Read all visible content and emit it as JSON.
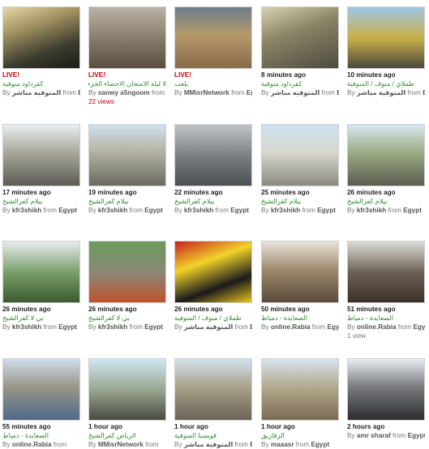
{
  "cards": [
    {
      "status": "LIVE!",
      "live": true,
      "title": "كفرداود منوفية",
      "by": "By",
      "user": "المنوفية مباشر",
      "from": "from",
      "place": "Egypt",
      "views": "",
      "views_red": false,
      "scene": "linear-gradient(160deg,#e8d9a8 0%,#9a8c5c 35%,#3a3a2e 70%,#1c1c18 100%)"
    },
    {
      "status": "LIVE!",
      "live": true,
      "title": "لا ليلة الامتحان الاحصاء الجزء الاول",
      "by": "By",
      "user": "sanwy a5ngoom",
      "from": "from",
      "place": "Egypt",
      "views": "22 views",
      "views_red": true,
      "scene": "linear-gradient(180deg,#b9b2a6 0%,#8a7d6d 50%,#5a4d40 100%)"
    },
    {
      "status": "LIVE!",
      "live": true,
      "title": "يلعب",
      "by": "By",
      "user": "MMisrNetwork",
      "from": "from",
      "place": "Egypt",
      "views": "",
      "views_red": false,
      "scene": "linear-gradient(180deg,#6c7c8c 0%,#b49a6a 45%,#8a6a4a 100%)"
    },
    {
      "status": "8 minutes ago",
      "live": false,
      "title": "كفرداود منوفية",
      "by": "By",
      "user": "المنوفية مباشر",
      "from": "from",
      "place": "Egypt",
      "views": "",
      "views_red": false,
      "scene": "linear-gradient(160deg,#d9d2b2 0%,#8c8668 40%,#4c4a3c 100%)"
    },
    {
      "status": "10 minutes ago",
      "live": false,
      "title": "طملاي / منوف / المنوفية",
      "by": "By",
      "user": "المنوفية مباشر",
      "from": "from",
      "place": "Egypt",
      "views": "",
      "views_red": false,
      "scene": "linear-gradient(180deg,#9fc6e6 0%,#c9b04a 50%,#4a4a3c 100%)"
    },
    {
      "status": "17 minutes ago",
      "live": false,
      "title": "بيلام كفرالشيخ",
      "by": "By",
      "user": "kfr3shikh",
      "from": "from",
      "place": "Egypt",
      "views": "",
      "views_red": false,
      "scene": "linear-gradient(180deg,#eaeef0 0%,#a8a89a 45%,#5c5c54 100%)"
    },
    {
      "status": "19 minutes ago",
      "live": false,
      "title": "بيلام كفرالشيخ",
      "by": "By",
      "user": "kfr3shikh",
      "from": "from",
      "place": "Egypt",
      "views": "",
      "views_red": false,
      "scene": "linear-gradient(180deg,#cfe0ec 0%,#b8b8aa 40%,#6a6a60 100%)"
    },
    {
      "status": "22 minutes ago",
      "live": false,
      "title": "بيلام كفرالشيخ",
      "by": "By",
      "user": "kfr3shikh",
      "from": "from",
      "place": "Egypt",
      "views": "",
      "views_red": false,
      "scene": "linear-gradient(180deg,#bfc4c8 0%,#7c8084 50%,#4c5054 100%)"
    },
    {
      "status": "25 minutes ago",
      "live": false,
      "title": "بيلام كفرالشيخ",
      "by": "By",
      "user": "kfr3shikh",
      "from": "from",
      "place": "Egypt",
      "views": "",
      "views_red": false,
      "scene": "linear-gradient(180deg,#cfe2f0 0%,#d8d8d0 45%,#8a8a80 100%)"
    },
    {
      "status": "26 minutes ago",
      "live": false,
      "title": "بيلام كفرالشيخ",
      "by": "By",
      "user": "kfr3shikh",
      "from": "from",
      "place": "Egypt",
      "views": "",
      "views_red": false,
      "scene": "linear-gradient(180deg,#d6e6f0 0%,#9cae86 45%,#5c5c50 100%)"
    },
    {
      "status": "26 minutes ago",
      "live": false,
      "title": "بي لا كفرالشيخ",
      "by": "By",
      "user": "kfr3shikh",
      "from": "from",
      "place": "Egypt",
      "views": "",
      "views_red": false,
      "scene": "linear-gradient(180deg,#e8ecef 0%,#7aa06a 50%,#3c5a30 100%)"
    },
    {
      "status": "26 minutes ago",
      "live": false,
      "title": "بي لا كفرالشيخ",
      "by": "By",
      "user": "kfr3shikh",
      "from": "from",
      "place": "Egypt",
      "views": "",
      "views_red": false,
      "scene": "linear-gradient(180deg,#6a9c5a 0%,#8a8878 50%,#c0522c 100%)"
    },
    {
      "status": "26 minutes ago",
      "live": false,
      "title": "طملاي / منوف / المنوفية",
      "by": "By",
      "user": "المنوفية مباشر",
      "from": "from",
      "place": "Egypt",
      "views": "",
      "views_red": false,
      "scene": "linear-gradient(160deg,#c8201e 0%,#f2d22a 35%,#1a1a1a 70%,#e8c420 100%)"
    },
    {
      "status": "50 minutes ago",
      "live": false,
      "title": "الصعايدة - دمياط",
      "by": "By",
      "user": "online.Rabia",
      "from": "from",
      "place": "Egypt",
      "views": "",
      "views_red": false,
      "scene": "linear-gradient(180deg,#e8e4da 0%,#a08a70 45%,#5a4a3a 100%)"
    },
    {
      "status": "51 minutes ago",
      "live": false,
      "title": "الصعايدة - دمياط",
      "by": "By",
      "user": "online.Rabia",
      "from": "from",
      "place": "Egypt",
      "views": "1 view",
      "views_red": false,
      "scene": "linear-gradient(180deg,#dcdcd8 0%,#6e6256 50%,#3a3028 100%)"
    },
    {
      "status": "55 minutes ago",
      "live": false,
      "title": "الصعايدة - دمياط",
      "by": "By",
      "user": "online.Rabia",
      "from": "from",
      "place": "",
      "views": "",
      "views_red": false,
      "scene": "linear-gradient(180deg,#cfdcec 0%,#9a9688 45%,#4e6a8a 100%)"
    },
    {
      "status": "1 hour ago",
      "live": false,
      "title": "الرياض كفرالشيخ",
      "by": "By",
      "user": "MMisrNetwork",
      "from": "from",
      "place": "",
      "views": "",
      "views_red": false,
      "scene": "linear-gradient(180deg,#cfe6f4 0%,#9aa890 50%,#4a4a44 100%)"
    },
    {
      "status": "1 hour ago",
      "live": false,
      "title": "قويسنا المنوفية",
      "by": "By",
      "user": "المنوفية مباشر",
      "from": "from",
      "place": "Egypt",
      "views": "",
      "views_red": false,
      "scene": "linear-gradient(180deg,#d4e2ec 0%,#a49c84 50%,#6a6458 100%)"
    },
    {
      "status": "1 hour ago",
      "live": false,
      "title": "الزقازيق",
      "by": "By",
      "user": "maaasr",
      "from": "from",
      "place": "Egypt",
      "views": "",
      "views_red": false,
      "scene": "linear-gradient(180deg,#d8e4ee 0%,#b4aa90 45%,#7a6a52 100%)"
    },
    {
      "status": "2 hours ago",
      "live": false,
      "title": "",
      "by": "By",
      "user": "amr sharaf",
      "from": "from",
      "place": "Egypt",
      "views": "",
      "views_red": false,
      "scene": "linear-gradient(180deg,#e8eef2 0%,#7a7c80 45%,#2e2e32 100%)"
    }
  ]
}
